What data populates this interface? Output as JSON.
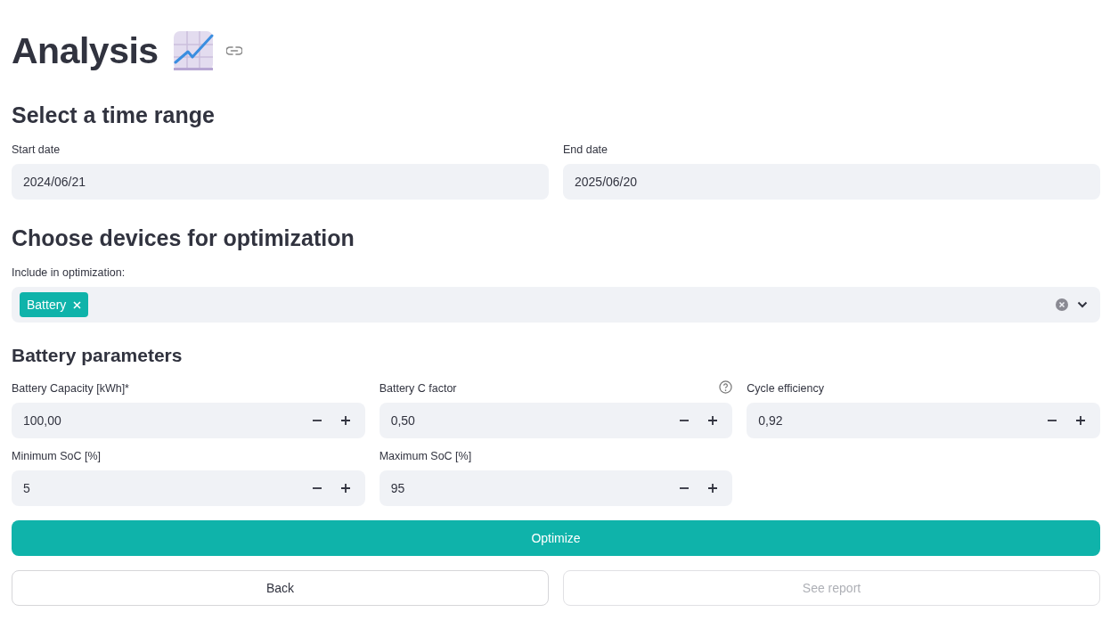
{
  "title": {
    "text": "Analysis"
  },
  "time_range": {
    "heading": "Select a time range",
    "fields": [
      {
        "label": "Start date",
        "value": "2024/06/21"
      },
      {
        "label": "End date",
        "value": "2025/06/20"
      }
    ]
  },
  "devices": {
    "heading": "Choose devices for optimization",
    "label": "Include in optimization:",
    "tags": [
      {
        "label": "Battery"
      }
    ]
  },
  "battery": {
    "heading": "Battery parameters",
    "fields": [
      {
        "label": "Battery Capacity [kWh]*",
        "value": "100,00",
        "help": false
      },
      {
        "label": "Battery C factor",
        "value": "0,50",
        "help": true
      },
      {
        "label": "Cycle efficiency",
        "value": "0,92",
        "help": false
      },
      {
        "label": "Minimum SoC [%]",
        "value": "5",
        "help": false
      },
      {
        "label": "Maximum SoC [%]",
        "value": "95",
        "help": false
      }
    ]
  },
  "buttons": [
    {
      "label": "Optimize",
      "kind": "primary",
      "disabled": false
    },
    {
      "label": "Back",
      "kind": "secondary",
      "disabled": false
    },
    {
      "label": "See report",
      "kind": "secondary",
      "disabled": true
    }
  ]
}
